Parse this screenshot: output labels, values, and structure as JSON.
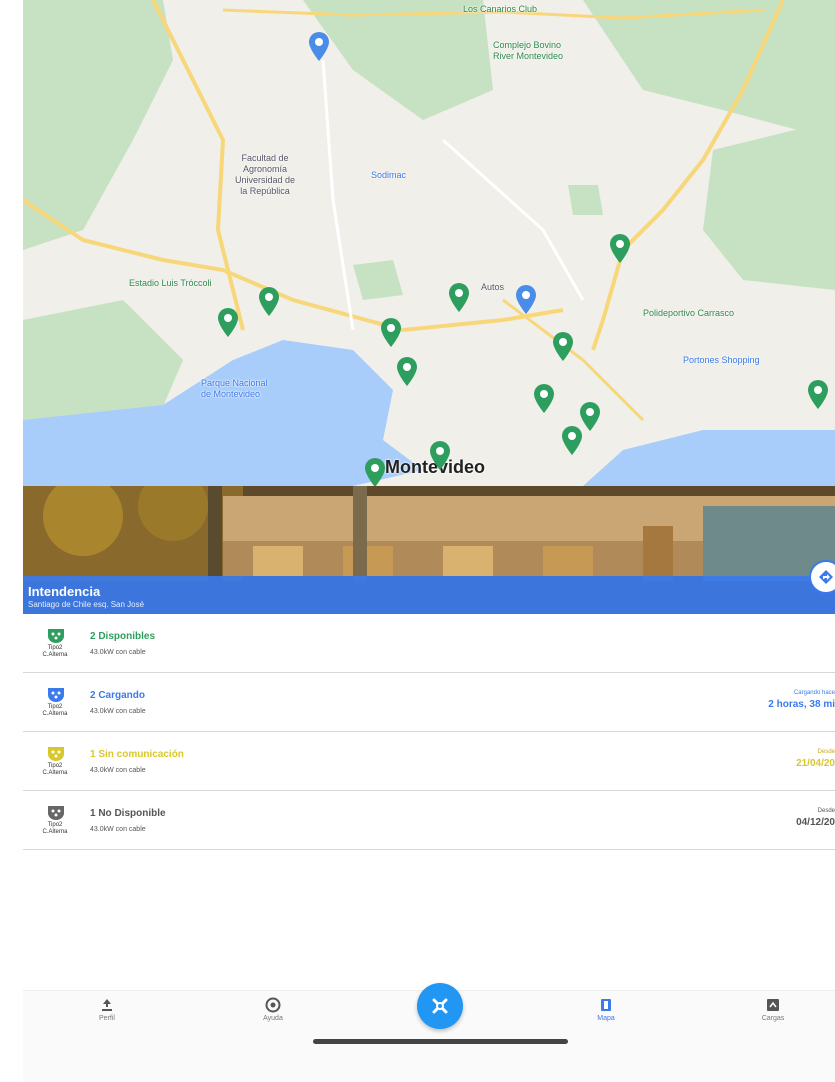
{
  "map": {
    "city_label": "Montevideo",
    "labels": {
      "club": "Los Canarios Club",
      "complex": "Complejo Bovino\nRiver Montevideo",
      "faculty": "Facultad de\nAgronomía\nUniversidad de\nla República",
      "sodimac": "Sodimac",
      "stadium": "Estadio Luis Tróccoli",
      "auto": "Autos",
      "polideportivo": "Polideportivo Carrasco",
      "shopping": "Portones Shopping",
      "parque": "Parque Nacional\nde Montevideo"
    },
    "colors": {
      "water": "#a9cdfb",
      "park": "#c7e2c2",
      "road": "#f7d77a",
      "pin_green": "#2e9e5e",
      "pin_blue": "#4a8de8"
    }
  },
  "station": {
    "name": "Intendencia",
    "address": "Santiago de Chile esq. San José"
  },
  "connectors": [
    {
      "status": "2 Disponibles",
      "plug_type": "Tipo2\nC.Alterna",
      "power": "43.0kW con cable",
      "status_color": "#2e9e5e",
      "icon_color": "#2e9e5e",
      "right_label": "",
      "right_value": ""
    },
    {
      "status": "2 Cargando",
      "plug_type": "Tipo2\nC.Alterna",
      "power": "43.0kW con cable",
      "status_color": "#3a7aeb",
      "icon_color": "#3a7aeb",
      "right_label": "Cargando hace",
      "right_value": "2 horas, 38 mi"
    },
    {
      "status": "1 Sin comunicación",
      "plug_type": "Tipo2\nC.Alterna",
      "power": "43.0kW con cable",
      "status_color": "#d9c82a",
      "icon_color": "#d9c82a",
      "right_label": "Desde",
      "right_value": "21/04/20"
    },
    {
      "status": "1 No Disponible",
      "plug_type": "Tipo2\nC.Alterna",
      "power": "43.0kW con cable",
      "status_color": "#555555",
      "icon_color": "#666666",
      "right_label": "Desde",
      "right_value": "04/12/20"
    }
  ],
  "tabs": [
    {
      "label": "Perfil",
      "icon": "person-icon"
    },
    {
      "label": "Ayuda",
      "icon": "help-icon"
    },
    {
      "label": "Mapa",
      "icon": "map-icon",
      "active": true
    },
    {
      "label": "Cargas",
      "icon": "charges-icon"
    }
  ],
  "fab_icon": "plug-icon"
}
